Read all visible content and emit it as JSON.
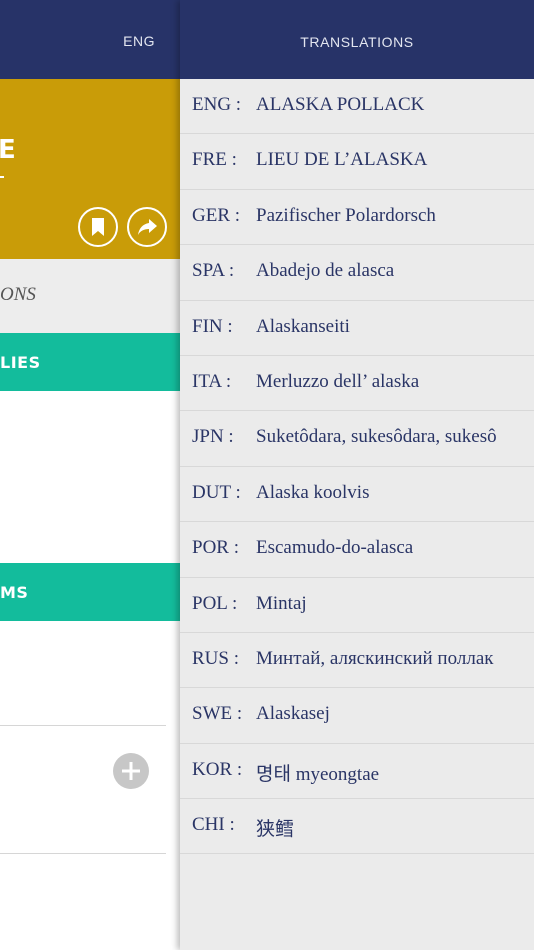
{
  "left_panel": {
    "header": {
      "language": "ENG"
    },
    "hero": {
      "title_fragment": "E"
    },
    "subheading_fragment": "ONS",
    "families_fragment": "LIES",
    "items_fragment": "MS"
  },
  "right_panel": {
    "title": "TRANSLATIONS",
    "translations": [
      {
        "code": "ENG :",
        "name": "ALASKA POLLACK"
      },
      {
        "code": "FRE :",
        "name": "LIEU DE L’ALASKA"
      },
      {
        "code": "GER :",
        "name": "Pazifischer Polardorsch"
      },
      {
        "code": "SPA :",
        "name": "Abadejo de alasca"
      },
      {
        "code": "FIN :",
        "name": "Alaskanseiti"
      },
      {
        "code": "ITA :",
        "name": "Merluzzo dell’ alaska"
      },
      {
        "code": "JPN :",
        "name": "Suketôdara, sukesôdara, sukesô"
      },
      {
        "code": "DUT :",
        "name": "Alaska koolvis"
      },
      {
        "code": "POR :",
        "name": "Escamudo-do-alasca"
      },
      {
        "code": "POL :",
        "name": "Mintaj"
      },
      {
        "code": "RUS :",
        "name": "Минтай, аляскинский поллак"
      },
      {
        "code": "SWE :",
        "name": "Alaskasej"
      },
      {
        "code": "KOR :",
        "name": "명태 myeongtae"
      },
      {
        "code": "CHI :",
        "name": "狭鳕"
      }
    ]
  },
  "colors": {
    "header": "#273368",
    "hero": "#c99c08",
    "teal": "#13bc9c",
    "panel_bg": "#ebebeb",
    "text": "#2a3566"
  },
  "icons": [
    "bookmark-icon",
    "share-icon",
    "plus-icon"
  ]
}
